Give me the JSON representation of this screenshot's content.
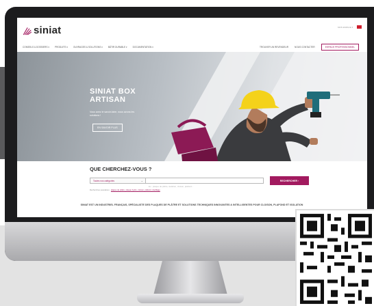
{
  "brand": {
    "logo_text": "siniat",
    "accent_color": "#a21a5f"
  },
  "util": {
    "pro_label": "MON ESPACE ▾"
  },
  "nav": {
    "items": [
      "CONSEILS & DOSSIERS ▾",
      "PRODUITS ▾",
      "OUVRAGES & SOLUTIONS ▾",
      "BÂTIR DURABLE ▾",
      "DOCUMENTATION ▾"
    ],
    "right_link": "TROUVER UN REVENDEUR",
    "right_link2": "NOUS CONTACTER",
    "pro_button": "ESPACE PROFESSIONNEL"
  },
  "hero": {
    "title": "SINIAT BOX ARTISAN",
    "subtitle": "Vous avez le savoir-faire, nous avons les solutions !",
    "button": "EN SAVOIR PLUS"
  },
  "search": {
    "title": "QUE CHERCHEZ-VOUS ?",
    "category_value": "Toutes nos catégories",
    "placeholder": "Ex : plaque de plâtre, isolation, cloison, plafond...",
    "button": "RECHERCHER ›",
    "popular_label": "Recherches populaires :",
    "popular_links": "plaque de plâtre, plaque hydro, cloison, plafond, doublage"
  },
  "tagline": "SINIAT EST UN INDUSTRIEL FRANÇAIS, SPÉCIALISTE DES PLAQUES DE PLÂTRE ET SOLUTIONS TECHNIQUES INNOVANTES & INTELLIGENTES POUR CLOISON, PLAFOND ET ISOLATION"
}
